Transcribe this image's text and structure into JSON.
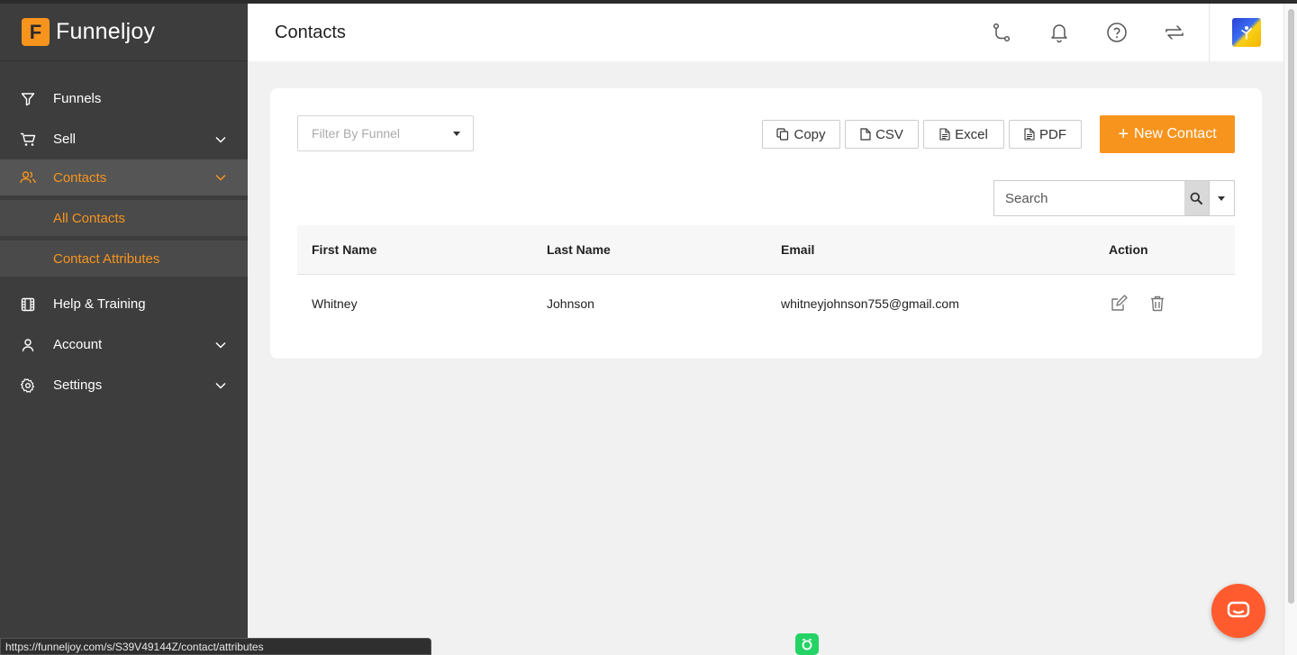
{
  "brand": {
    "logo_letter": "F",
    "name": "Funneljoy"
  },
  "sidebar": {
    "items": [
      {
        "label": "Funnels",
        "icon": "filter-icon"
      },
      {
        "label": "Sell",
        "icon": "cart-icon"
      },
      {
        "label": "Contacts",
        "icon": "users-icon",
        "active": true
      },
      {
        "label": "Help & Training",
        "icon": "film-icon"
      },
      {
        "label": "Account",
        "icon": "user-icon"
      },
      {
        "label": "Settings",
        "icon": "gear-icon"
      }
    ],
    "contacts_sub": [
      "All Contacts",
      "Contact Attributes"
    ]
  },
  "header": {
    "title": "Contacts",
    "icons": [
      "route-icon",
      "bell-icon",
      "help-icon",
      "swap-icon"
    ]
  },
  "toolbar": {
    "filter_placeholder": "Filter By Funnel",
    "copy_label": "Copy",
    "csv_label": "CSV",
    "excel_label": "Excel",
    "pdf_label": "PDF",
    "new_contact_plus": "+",
    "new_contact_label": "New Contact",
    "search_placeholder": "Search"
  },
  "table": {
    "headers": [
      "First Name",
      "Last Name",
      "Email",
      "Action"
    ],
    "rows": [
      {
        "first": "Whitney",
        "last": "Johnson",
        "email": "whitneyjohnson755@gmail.com"
      }
    ]
  },
  "status_url": "https://funneljoy.com/s/S39V49144Z/contact/attributes",
  "colors": {
    "accent": "#f7941d",
    "sidebar_bg": "#3d3d3d",
    "content_bg": "#f1f1f1",
    "chat": "#ff5b2e"
  }
}
